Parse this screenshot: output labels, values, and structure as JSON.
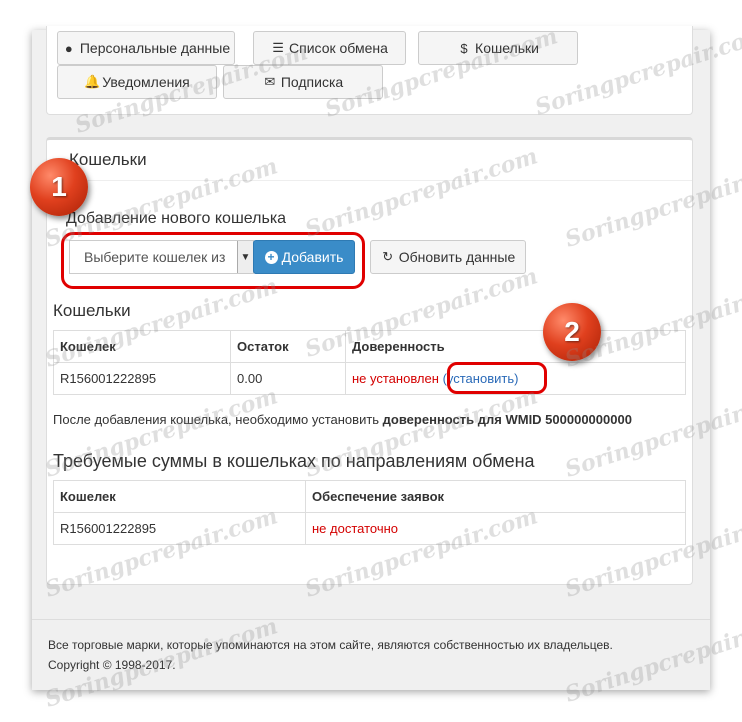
{
  "nav": {
    "personal": "Персональные данные",
    "exchange_list": "Список обмена",
    "wallets": "Кошельки",
    "notifications": "Уведомления",
    "subscription": "Подписка"
  },
  "section": {
    "title": "Кошельки",
    "add_title": "Добавление нового кошелька",
    "select_placeholder": "Выберите кошелек из",
    "add_button": "Добавить",
    "refresh_button": "Обновить данные"
  },
  "wallets": {
    "title": "Кошельки",
    "headers": [
      "Кошелек",
      "Остаток",
      "Доверенность"
    ],
    "rows": [
      {
        "wallet": "R156001222895",
        "balance": "0.00",
        "status": "не установлен",
        "action": "(установить)"
      }
    ]
  },
  "note": {
    "prefix": "После добавления кошелька, необходимо установить ",
    "bold": "доверенность для WMID 500000000000"
  },
  "required": {
    "title": "Требуемые суммы в кошельках по направлениям обмена",
    "headers": [
      "Кошелек",
      "Обеспечение заявок"
    ],
    "rows": [
      {
        "wallet": "R156001222895",
        "status": "не достаточно"
      }
    ]
  },
  "footer": {
    "line1": "Все торговые марки, которые упоминаются на этом сайте, являются собственностью их владельцев.",
    "line2": "Copyright © 1998-2017."
  },
  "badges": [
    "1",
    "2"
  ],
  "watermark": "Soringpcrepair.com",
  "colors": {
    "accent": "#3a8cc8",
    "danger": "#d40000",
    "link": "#2a6ab8",
    "highlight": "#e00000"
  }
}
